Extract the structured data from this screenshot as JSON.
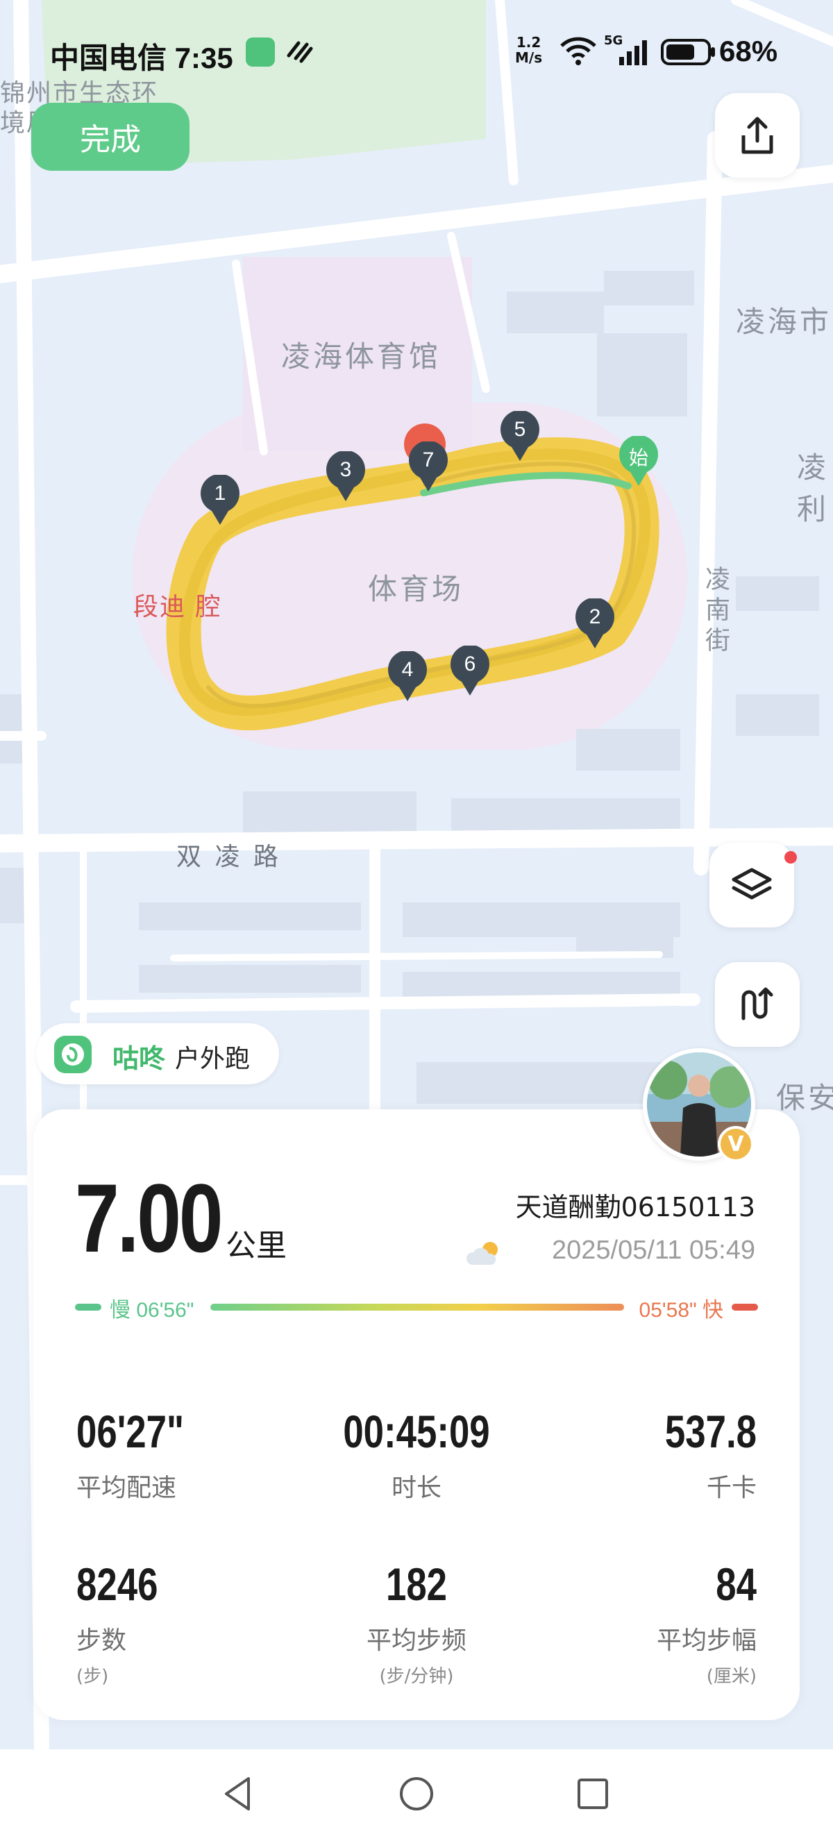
{
  "status_bar": {
    "carrier_time": "中国电信 7:35",
    "net_speed_value": "1.2",
    "net_speed_unit": "M/s",
    "network_type": "5G",
    "battery": "68%"
  },
  "header": {
    "done_label": "完成",
    "share_icon": "share-icon"
  },
  "map": {
    "labels": {
      "top_left_1": "锦州市生态环",
      "top_left_2": "境局",
      "gym": "凌海体育馆",
      "stadium": "体育场",
      "right_top": "凌海市",
      "right_mid_1": "凌",
      "right_mid_2": "利",
      "street": "凌南街",
      "poi_red": "段迪 腔",
      "road": "双 凌 路",
      "right_bottom": "保安"
    },
    "markers": [
      "1",
      "2",
      "3",
      "4",
      "5",
      "6",
      "7"
    ],
    "start_marker": "始",
    "layers_icon": "layers-icon",
    "route_icon": "route-icon"
  },
  "app_badge": {
    "app_name": "咕咚",
    "activity_type": "户外跑"
  },
  "summary": {
    "distance": "7.00",
    "distance_unit": "公里",
    "username": "天道酬勤06150113",
    "datetime": "2025/05/11 05:49",
    "weather_icon": "partly-cloudy-icon",
    "verified_badge": "V",
    "pace_slow_label": "慢 06'56\"",
    "pace_fast_label": "05'58\" 快",
    "stats": [
      {
        "value": "06'27\"",
        "label": "平均配速",
        "sub": ""
      },
      {
        "value": "00:45:09",
        "label": "时长",
        "sub": ""
      },
      {
        "value": "537.8",
        "label": "千卡",
        "sub": ""
      },
      {
        "value": "8246",
        "label": "步数",
        "sub": "(步)"
      },
      {
        "value": "182",
        "label": "平均步频",
        "sub": "(步/分钟)"
      },
      {
        "value": "84",
        "label": "平均步幅",
        "sub": "(厘米)"
      }
    ]
  },
  "colors": {
    "accent_green": "#5fcb8a",
    "route_yellow": "#f2c93a",
    "marker_dark": "#3d4a56",
    "pace_fast": "#e8774f"
  }
}
